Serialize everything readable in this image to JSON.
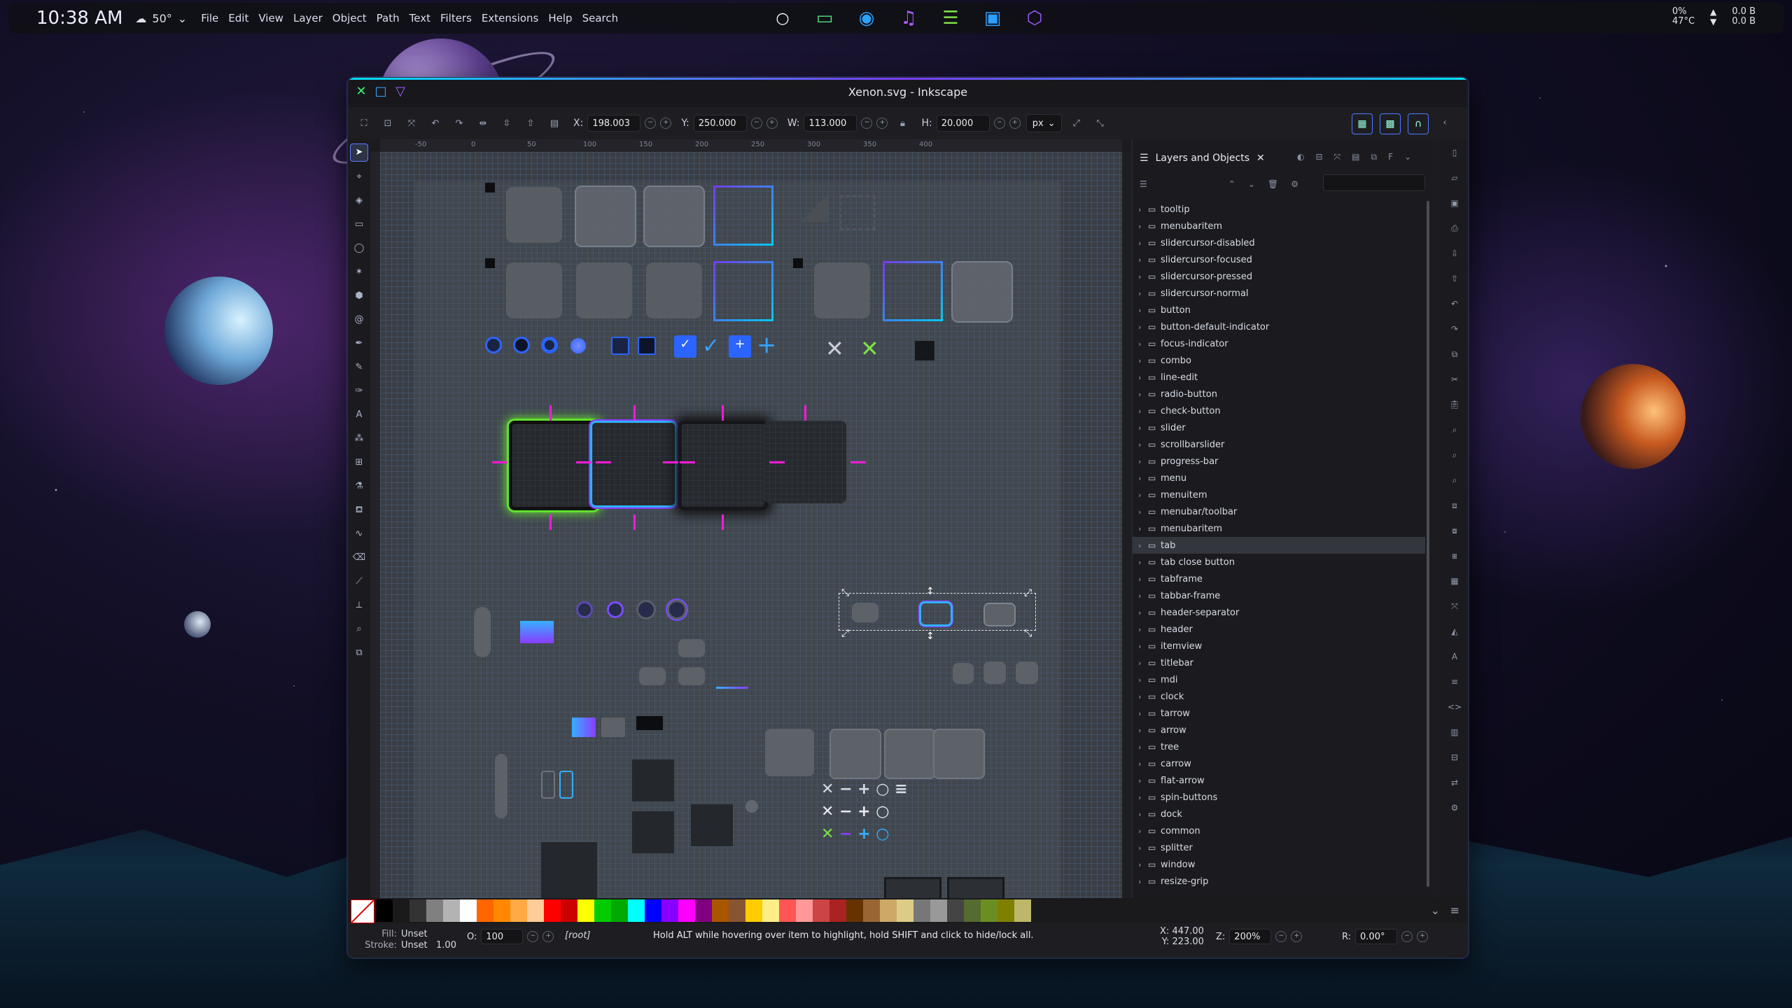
{
  "top_panel": {
    "time": "10:38 AM",
    "temperature": "50°",
    "menu": [
      "File",
      "Edit",
      "View",
      "Layer",
      "Object",
      "Path",
      "Text",
      "Filters",
      "Extensions",
      "Help",
      "Search"
    ],
    "dock": [
      "circle-icon",
      "folder-icon",
      "browser-icon",
      "music-icon",
      "notes-icon",
      "terminal-icon",
      "ai-icon"
    ],
    "tray": {
      "cpu": "0%",
      "temp": "47°C",
      "net_up": "0.0 B",
      "net_down": "0.0 B"
    }
  },
  "window": {
    "title": "Xenon.svg - Inkscape",
    "toolbar": {
      "x_label": "X:",
      "x_value": "198.003",
      "y_label": "Y:",
      "y_value": "250.000",
      "w_label": "W:",
      "w_value": "113.000",
      "h_label": "H:",
      "h_value": "20.000",
      "unit": "px"
    },
    "ruler_ticks": [
      "-50",
      "0",
      "50",
      "100",
      "150",
      "200",
      "250",
      "300",
      "350",
      "400"
    ]
  },
  "layers_panel": {
    "title": "Layers and Objects",
    "search_placeholder": "",
    "selected_item": "tab",
    "items": [
      "tooltip",
      "menubaritem",
      "slidercursor-disabled",
      "slidercursor-focused",
      "slidercursor-pressed",
      "slidercursor-normal",
      "button",
      "button-default-indicator",
      "focus-indicator",
      "combo",
      "line-edit",
      "radio-button",
      "check-button",
      "slider",
      "scrollbarslider",
      "progress-bar",
      "menu",
      "menuitem",
      "menubar/toolbar",
      "menubaritem",
      "tab",
      "tab close button",
      "tabframe",
      "tabbar-frame",
      "header-separator",
      "header",
      "itemview",
      "titlebar",
      "mdi",
      "clock",
      "tarrow",
      "arrow",
      "tree",
      "carrow",
      "flat-arrow",
      "spin-buttons",
      "dock",
      "common",
      "splitter",
      "window",
      "resize-grip"
    ]
  },
  "status": {
    "fill_label": "Fill:",
    "fill_value": "Unset",
    "stroke_label": "Stroke:",
    "stroke_value": "Unset",
    "stroke_width": "1.00",
    "opacity_label": "O:",
    "opacity_value": "100",
    "layer": "[root]",
    "message": "Hold ALT while hovering over item to highlight, hold SHIFT and click to hide/lock all.",
    "x_label": "X:",
    "x_value": "447.00",
    "y_label": "Y:",
    "y_value": "223.00",
    "zoom_label": "Z:",
    "zoom_value": "200%",
    "rotation_label": "R:",
    "rotation_value": "0.00°"
  },
  "palette": [
    "#000000",
    "#1a1a1a",
    "#333333",
    "#808080",
    "#b3b3b3",
    "#ffffff",
    "#ff6600",
    "#ff8800",
    "#ffaa44",
    "#ffcc99",
    "#ff0000",
    "#cc0000",
    "#ffff00",
    "#00cc00",
    "#00aa00",
    "#00ffff",
    "#0000ff",
    "#8800ff",
    "#ff00ff",
    "#800080",
    "#aa5500",
    "#885533",
    "#ffcc00",
    "#ffee88",
    "#ff5555",
    "#ff9999",
    "#cc4444",
    "#aa2222",
    "#663300",
    "#996633",
    "#ccaa66",
    "#ddcc88",
    "#777777",
    "#999999",
    "#444444",
    "#556b2f",
    "#6b8e23",
    "#808000",
    "#bdb76b"
  ]
}
